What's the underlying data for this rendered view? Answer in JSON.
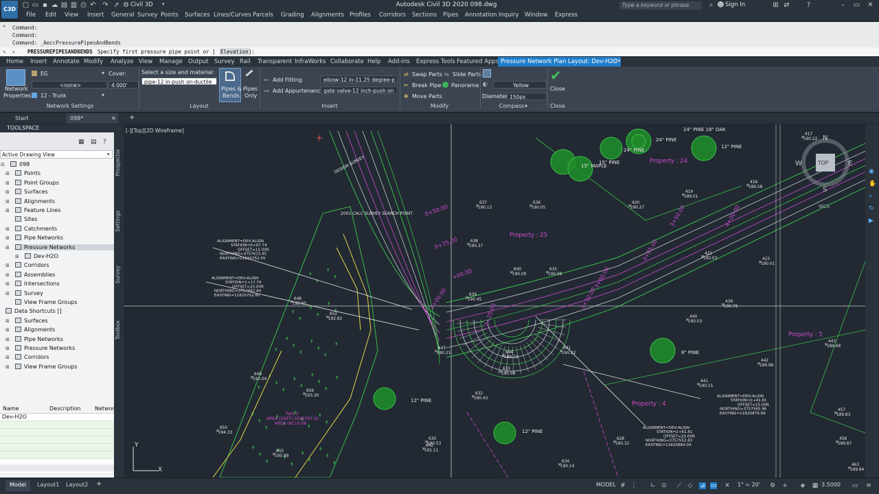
{
  "titlebar": {
    "app_icon_label": "C3D",
    "workspace": "Civil 3D",
    "doc_title": "Autodesk Civil 3D 2020   098.dwg",
    "search_placeholder": "Type a keyword or phrase",
    "signin": "Sign In"
  },
  "menu": [
    "File",
    "Edit",
    "View",
    "Insert",
    "General",
    "Survey",
    "Points",
    "Surfaces",
    "Lines/Curves",
    "Parcels",
    "Grading",
    "Alignments",
    "Profiles",
    "Corridors",
    "Sections",
    "Pipes",
    "Annotation",
    "Inquiry",
    "Window",
    "Express"
  ],
  "command": {
    "line1": "Command:",
    "line2": "Command:",
    "line3": "Command: _AeccPressurePipesAndBends",
    "prompt_cmd": "PRESSUREPIPESANDBENDS",
    "prompt_text": "Specify first pressure pipe point or [",
    "prompt_option": "Elevation",
    "prompt_end": "]:"
  },
  "ribbon_tabs": [
    "Home",
    "Insert",
    "Annotate",
    "Modify",
    "Analyze",
    "View",
    "Manage",
    "Output",
    "Survey",
    "Rail",
    "Transparent",
    "InfraWorks",
    "Collaborate",
    "Help",
    "Add-ins",
    "Express Tools",
    "Featured Apps"
  ],
  "ribbon_active_tab": "Pressure Network Plan Layout: Dev-H2O",
  "ribbon": {
    "network_settings": {
      "props_line1": "Network",
      "props_line2": "Properties",
      "surface": "EG",
      "cover_label": "Cover:",
      "cover_value": "4.000'",
      "alignment": "<none>",
      "parts_list": "12 - Trunk",
      "title": "Network Settings"
    },
    "layout": {
      "size_label": "Select a size and material:",
      "size_value": "pipe-12 in-push on-ductile",
      "pipes_bends_line1": "Pipes &",
      "pipes_bends_line2": "Bends",
      "pipes_only_line1": "Pipes",
      "pipes_only_line2": "Only",
      "title": "Layout"
    },
    "insert": {
      "add_fitting": "Add Fitting",
      "fitting_value": "elbow-12 in-11.25 degree-p",
      "add_appurtenance": "Add Appurtenance",
      "appurtenance_value": "gate valve-12 inch-push on",
      "title": "Insert"
    },
    "modify": {
      "swap_parts": "Swap Parts",
      "slide_parts": "Slide Parts",
      "break_pipe": "Break Pipe",
      "panorama": "Panorama",
      "move_parts": "Move Parts",
      "title": "Modify"
    },
    "compass": {
      "color": "Yellow",
      "diameter_label": "Diameter:",
      "diameter_value": "150px",
      "title": "Compass"
    },
    "close": {
      "label": "Close",
      "title": "Close"
    }
  },
  "file_tabs": {
    "start": "Start",
    "file": "098*"
  },
  "toolspace": {
    "title": "TOOLSPACE",
    "view": "Active Drawing View",
    "tree_root": "098",
    "tree": [
      {
        "label": "Points",
        "level": 1
      },
      {
        "label": "Point Groups",
        "level": 1
      },
      {
        "label": "Surfaces",
        "level": 1
      },
      {
        "label": "Alignments",
        "level": 1
      },
      {
        "label": "Feature Lines",
        "level": 1
      },
      {
        "label": "Sites",
        "level": 1
      },
      {
        "label": "Catchments",
        "level": 1
      },
      {
        "label": "Pipe Networks",
        "level": 1
      },
      {
        "label": "Pressure Networks",
        "level": 1
      },
      {
        "label": "Dev-H2O",
        "level": 2
      },
      {
        "label": "Corridors",
        "level": 1
      },
      {
        "label": "Assemblies",
        "level": 1
      },
      {
        "label": "Intersections",
        "level": 1
      },
      {
        "label": "Survey",
        "level": 1
      },
      {
        "label": "View Frame Groups",
        "level": 1
      }
    ],
    "shortcuts_root": "Data Shortcuts []",
    "shortcuts": [
      "Surfaces",
      "Alignments",
      "Pipe Networks",
      "Pressure Networks",
      "Corridors",
      "View Frame Groups"
    ],
    "table_headers": [
      "Name",
      "Description",
      "Networ"
    ],
    "table_rows": [
      "Dev-H2O"
    ],
    "side_tabs": [
      "Prospector",
      "Settings",
      "Survey",
      "Toolbox"
    ]
  },
  "viewport": {
    "label": "[-][Top][2D Wireframe]",
    "compass": {
      "n": "N",
      "s": "S",
      "e": "E",
      "w": "W",
      "top": "TOP",
      "wcs": "WCS"
    },
    "properties": [
      "Property : 24",
      "Property : 25",
      "Property : 5",
      "Property : 4"
    ],
    "stations": [
      "0+50.00",
      "0+75.00",
      "+00.00",
      "2+00.00",
      "2+25.00",
      "2+50.00",
      "3+00.00",
      "3+25.00",
      "3+50.00",
      "4+00.00"
    ],
    "trees": [
      "24\" PINE 18\" OAK",
      "24\" PINE",
      "24\" PINE",
      "12\" PINE",
      "15\" MAPLE",
      "15\" PINE",
      "8\" PINE",
      "12\" PINE",
      "12\" PINE"
    ],
    "align_notes": [
      [
        "ALIGNMENT=DEV-ALIGN",
        "STATION=0+97.74",
        "OFFSET=15.00R",
        "NORTHING=3757623.45",
        "EASTING=11820752.05"
      ],
      [
        "ALIGNMENT=DEV-ALIGN",
        "STATION=1+17.74",
        "OFFSET=20.00R",
        "NORTHING=3757662.84",
        "EASTING=11820752.80"
      ],
      [
        "ALIGNMENT=DEV-ALIGN",
        "STATION=2+61.81",
        "OFFSET=20.00R",
        "NORTHING=3757552.83",
        "EASTING=11820884.09"
      ],
      [
        "ALIGNMENT=DEV-ALIGN",
        "STATION=2+41.81",
        "OFFSET=15.00R",
        "NORTHING=3757565.96",
        "EASTING=11820879.99"
      ]
    ],
    "points": [
      [
        "637",
        "190.12"
      ],
      [
        "636",
        "190.05"
      ],
      [
        "638",
        "190.37"
      ],
      [
        "640",
        "190.09"
      ],
      [
        "635",
        "190.08"
      ],
      [
        "639",
        "190.45"
      ],
      [
        "420",
        "190.27"
      ],
      [
        "419",
        "189.01"
      ],
      [
        "418",
        "189.58"
      ],
      [
        "417",
        "190.22"
      ],
      [
        "421",
        "190.03"
      ],
      [
        "423",
        "190.01"
      ],
      [
        "439",
        "190.76"
      ],
      [
        "440",
        "190.03"
      ],
      [
        "441",
        "190.15"
      ],
      [
        "442",
        "189.96"
      ],
      [
        "443",
        "189.68"
      ],
      [
        "457",
        "189.83"
      ],
      [
        "458",
        "189.87"
      ],
      [
        "463",
        "189.84"
      ],
      [
        "630",
        "190.53"
      ],
      [
        "628",
        "190.32"
      ],
      [
        "642",
        "191.11"
      ],
      [
        "634",
        "190.14"
      ],
      [
        "648",
        "192.65"
      ],
      [
        "652",
        "192.82"
      ],
      [
        "649",
        "193.04"
      ],
      [
        "656",
        "193.30"
      ],
      [
        "650",
        "194.33"
      ],
      [
        "655",
        "195.99"
      ],
      [
        "643",
        "190.21"
      ],
      [
        "632",
        "190.43"
      ],
      [
        "633",
        "190.09"
      ],
      [
        "641",
        "190.22"
      ],
      [
        "644",
        "189.73"
      ]
    ],
    "area_note": [
      "Park 1",
      "AREA (SQFT):3599797.91",
      "AREA (AC):0.08"
    ],
    "design_label": "DESIGN SURVEY",
    "survey_point": "2001 CALC SURVEY SEARCH POINT"
  },
  "status": {
    "tabs": [
      "Model",
      "Layout1",
      "Layout2"
    ],
    "model": "MODEL",
    "scale": "1\" = 20'",
    "annoscale": "3.5000"
  }
}
